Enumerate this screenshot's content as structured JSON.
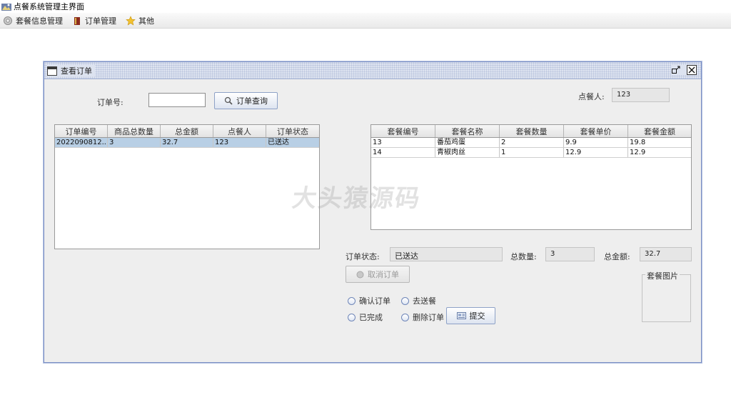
{
  "window": {
    "title": "点餐系统管理主界面"
  },
  "menubar": {
    "items": [
      {
        "label": "套餐信息管理",
        "icon": "gear-icon"
      },
      {
        "label": "订单管理",
        "icon": "book-icon"
      },
      {
        "label": "其他",
        "icon": "star-icon"
      }
    ]
  },
  "internal_frame": {
    "title": "查看订单",
    "order_no_label": "订单号:",
    "order_no_value": "",
    "query_button": "订单查询",
    "customer_label": "点餐人:",
    "customer_value": "123",
    "orders_table": {
      "headers": [
        "订单编号",
        "商品总数量",
        "总金额",
        "点餐人",
        "订单状态"
      ],
      "rows": [
        {
          "order_id": "2022090812...",
          "qty": "3",
          "amount": "32.7",
          "customer": "123",
          "status": "已送达"
        }
      ]
    },
    "items_table": {
      "headers": [
        "套餐编号",
        "套餐名称",
        "套餐数量",
        "套餐单价",
        "套餐金额"
      ],
      "rows": [
        {
          "id": "13",
          "name": "番茄鸡蛋",
          "qty": "2",
          "price": "9.9",
          "amount": "19.8"
        },
        {
          "id": "14",
          "name": "青椒肉丝",
          "qty": "1",
          "price": "12.9",
          "amount": "12.9"
        }
      ]
    },
    "status_label": "订单状态:",
    "status_value": "已送达",
    "total_qty_label": "总数量:",
    "total_qty_value": "3",
    "total_amount_label": "总金额:",
    "total_amount_value": "32.7",
    "cancel_button": "取消订单",
    "radios": {
      "confirm": "确认订单",
      "deliver": "去送餐",
      "done": "已完成",
      "delete": "删除订单"
    },
    "submit_button": "提交",
    "image_box_title": "套餐图片"
  },
  "watermark": "大头猿源码",
  "colors": {
    "selected_row": "#b8cfe5",
    "frame_border": "#7a8fc4",
    "panel_bg": "#eeeeee"
  }
}
